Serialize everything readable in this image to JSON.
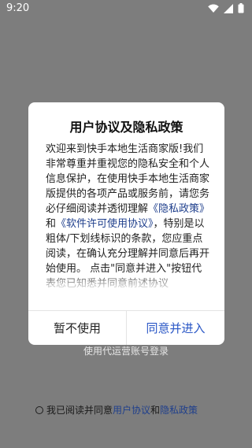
{
  "status_bar": {
    "time": "9:20",
    "icons": [
      "wifi-icon",
      "cellular-signal-icon",
      "battery-icon"
    ]
  },
  "background": {
    "login_link": "使用代运营账号登录",
    "agreement": {
      "prefix": "我已阅读并同意",
      "user_agreement": "用户协议",
      "and": "和",
      "privacy_policy": "隐私政策"
    }
  },
  "dialog": {
    "title": "用户协议及隐私政策",
    "body": {
      "part1": "欢迎来到快手本地生活商家版!我们非常尊重并重视您的隐私安全和个人信息保护，在使用快手本地生活商家版提供的各项产品或服务前，请您务必仔细阅读并透彻理解",
      "privacy_link": "《隐私政策》",
      "and": "和",
      "license_link": "《软件许可使用协议》",
      "part2": "，特别是以粗体/下划线标识的条款，您应重点阅读，在确认充分理解并同意后再开始使用。 点击\"同意并进入\"按钮代表您已知悉并同意前述协议"
    },
    "cancel_label": "暂不使用",
    "confirm_label": "同意并进入"
  },
  "colors": {
    "overlay": "#7d7d7d",
    "link": "#1f3f8c",
    "confirm": "#2a57c6"
  }
}
